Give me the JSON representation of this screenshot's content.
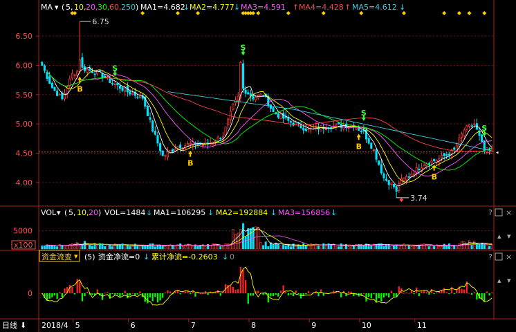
{
  "colors": {
    "up": "#ff3b3b",
    "down": "#00e5ff",
    "ma5": "#ffffff",
    "ma10": "#ffff00",
    "ma20": "#ff55ff",
    "ma30": "#00ff00",
    "ma60": "#ff4444",
    "ma250": "#3ad0e0",
    "axis": "#b31e1e",
    "grid": "#7a1414",
    "label_red": "#ff5050",
    "buy": "#ffcc00",
    "sell": "#33ff33",
    "flow_pos": "#ff2222",
    "flow_neg": "#00ff00",
    "flow_line": "#ffff00"
  },
  "price_header": {
    "name": "MA",
    "params_prefix": "(",
    "p1": "5,",
    "p2": "10,",
    "p3": "20,",
    "p4": "30,",
    "p5": "60,",
    "p6": "250",
    "params_suffix": ")",
    "ma1": "MA1=4.682",
    "ma1_arrow": "↓",
    "ma2": "MA2=4.777",
    "ma2_arrow": "↓",
    "ma3": "MA3=4.591",
    "ma3_arrow": "↑",
    "ma4": "MA4=4.428",
    "ma4_arrow": "↑",
    "ma5": "MA5=4.612",
    "ma5_arrow": "↓"
  },
  "vol_header": {
    "name": "VOL",
    "params_prefix": "(",
    "p1": "5,",
    "p2": "10,",
    "p3": "20",
    "params_suffix": ")",
    "vol": "VOL=1484",
    "vol_arrow": "↓",
    "ma1": "MA1=106295",
    "ma1_arrow": "↓",
    "ma2": "MA2=192884",
    "ma2_arrow": "↓",
    "ma3": "MA3=156856",
    "ma3_arrow": "↓"
  },
  "flow_header": {
    "name": "资金流变",
    "param": "(5)",
    "net": "资金净流=0",
    "net_arrow": "↓",
    "cum": "累计净流=-0.2603",
    "cum_arrow": "↓",
    "tail": "0"
  },
  "bottom_bar": {
    "period": "日线",
    "period_icon": "arrow-down-icon"
  },
  "markers": {
    "high_label": "6.75",
    "low_label": "3.74",
    "buy": "B",
    "sell": "S"
  },
  "chart_data": [
    {
      "type": "candlestick",
      "y_ticks": [
        "6.50",
        "6.00",
        "5.50",
        "5.00",
        "4.50",
        "4.00"
      ],
      "y_tick_values": [
        6.5,
        6.0,
        5.5,
        5.0,
        4.5,
        4.0
      ],
      "ylim": [
        3.62,
        6.88
      ],
      "x_labels": [
        "2018/4",
        "5",
        "6",
        "7",
        "8",
        "9",
        "10",
        "11"
      ],
      "legend_placement": "top",
      "high": 6.75,
      "low": 3.74,
      "last_close": 4.52,
      "close_anchors": [
        [
          0,
          6.0
        ],
        [
          4,
          5.62
        ],
        [
          8,
          5.42
        ],
        [
          12,
          5.85
        ],
        [
          16,
          5.95
        ],
        [
          22,
          5.88
        ],
        [
          28,
          5.7
        ],
        [
          34,
          5.55
        ],
        [
          40,
          5.45
        ],
        [
          44,
          4.9
        ],
        [
          48,
          4.45
        ],
        [
          54,
          4.62
        ],
        [
          60,
          4.66
        ],
        [
          66,
          4.66
        ],
        [
          72,
          4.8
        ],
        [
          76,
          5.3
        ],
        [
          80,
          5.6
        ],
        [
          84,
          5.45
        ],
        [
          88,
          5.5
        ],
        [
          92,
          5.2
        ],
        [
          98,
          5.05
        ],
        [
          106,
          4.9
        ],
        [
          112,
          4.95
        ],
        [
          118,
          4.97
        ],
        [
          124,
          4.98
        ],
        [
          128,
          4.85
        ],
        [
          132,
          4.55
        ],
        [
          136,
          4.08
        ],
        [
          140,
          3.93
        ],
        [
          146,
          4.12
        ],
        [
          152,
          4.32
        ],
        [
          158,
          4.4
        ],
        [
          164,
          4.55
        ],
        [
          168,
          4.9
        ],
        [
          172,
          5.0
        ],
        [
          176,
          4.55
        ]
      ],
      "buy_signals": [
        15,
        59,
        126,
        156
      ],
      "sell_signals": [
        29,
        80,
        128,
        176
      ]
    },
    {
      "type": "bar",
      "name": "VOL",
      "y_ticks": [
        "5000"
      ],
      "y_tick_values": [
        5000
      ],
      "unit_badge": "x100",
      "ylim": [
        0,
        7200
      ]
    },
    {
      "type": "bar",
      "name": "资金流变",
      "y_ticks": [
        "0"
      ],
      "y_tick_values": [
        0
      ],
      "ylim": [
        -1,
        1
      ]
    }
  ]
}
